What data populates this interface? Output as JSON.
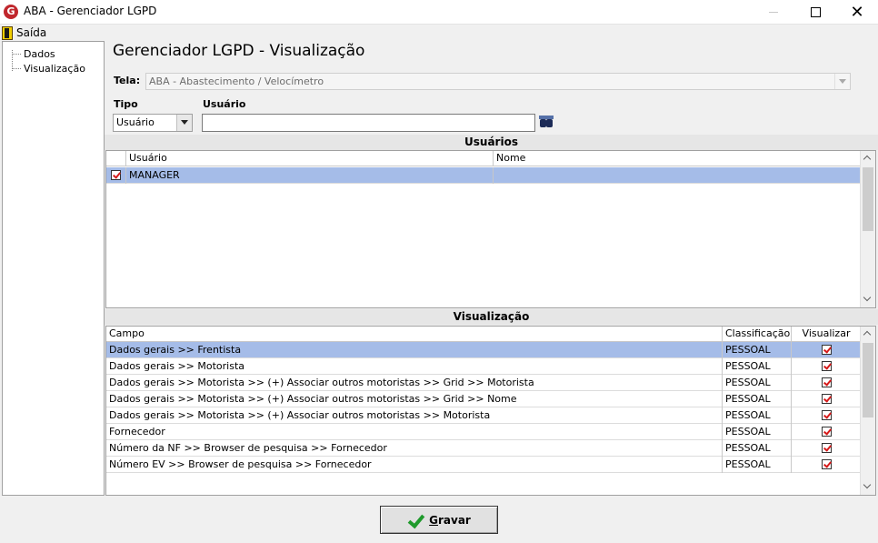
{
  "window": {
    "title": "ABA - Gerenciador LGPD",
    "icon_letter": "G",
    "close_symbol": "✕"
  },
  "menu": {
    "exit_label": "Saída"
  },
  "tree": {
    "items": [
      "Dados",
      "Visualização"
    ]
  },
  "heading": "Gerenciador LGPD - Visualização",
  "tela": {
    "label": "Tela:",
    "value": "ABA - Abastecimento / Velocímetro"
  },
  "tipo": {
    "label": "Tipo",
    "value": "Usuário"
  },
  "usuario_search": {
    "label": "Usuário",
    "value": ""
  },
  "usuarios_section": {
    "title": "Usuários",
    "columns": [
      "Usuário",
      "Nome"
    ],
    "rows": [
      {
        "usuario": "MANAGER",
        "nome": "",
        "checked": true
      }
    ]
  },
  "visualizacao_section": {
    "title": "Visualização",
    "columns": [
      "Campo",
      "Classificação",
      "Visualizar"
    ],
    "rows": [
      {
        "campo": "Dados gerais >> Frentista",
        "classificacao": "PESSOAL",
        "visualizar": true
      },
      {
        "campo": "Dados gerais >> Motorista",
        "classificacao": "PESSOAL",
        "visualizar": true
      },
      {
        "campo": "Dados gerais >> Motorista >> (+) Associar outros motoristas >> Grid >> Motorista",
        "classificacao": "PESSOAL",
        "visualizar": true
      },
      {
        "campo": "Dados gerais >> Motorista >> (+) Associar outros motoristas >> Grid >> Nome",
        "classificacao": "PESSOAL",
        "visualizar": true
      },
      {
        "campo": "Dados gerais >> Motorista >> (+) Associar outros motoristas >> Motorista",
        "classificacao": "PESSOAL",
        "visualizar": true
      },
      {
        "campo": "Fornecedor",
        "classificacao": "PESSOAL",
        "visualizar": true
      },
      {
        "campo": "Número da NF >> Browser de pesquisa >> Fornecedor",
        "classificacao": "PESSOAL",
        "visualizar": true
      },
      {
        "campo": "Número EV >> Browser de pesquisa >> Fornecedor",
        "classificacao": "PESSOAL",
        "visualizar": true
      }
    ]
  },
  "save_button": {
    "first_letter": "G",
    "rest": "ravar"
  },
  "colors": {
    "selected_row": "#a5bce8",
    "check_red": "#d51a1a",
    "save_check_green": "#1f9a2c",
    "app_icon_red": "#c0272d"
  }
}
